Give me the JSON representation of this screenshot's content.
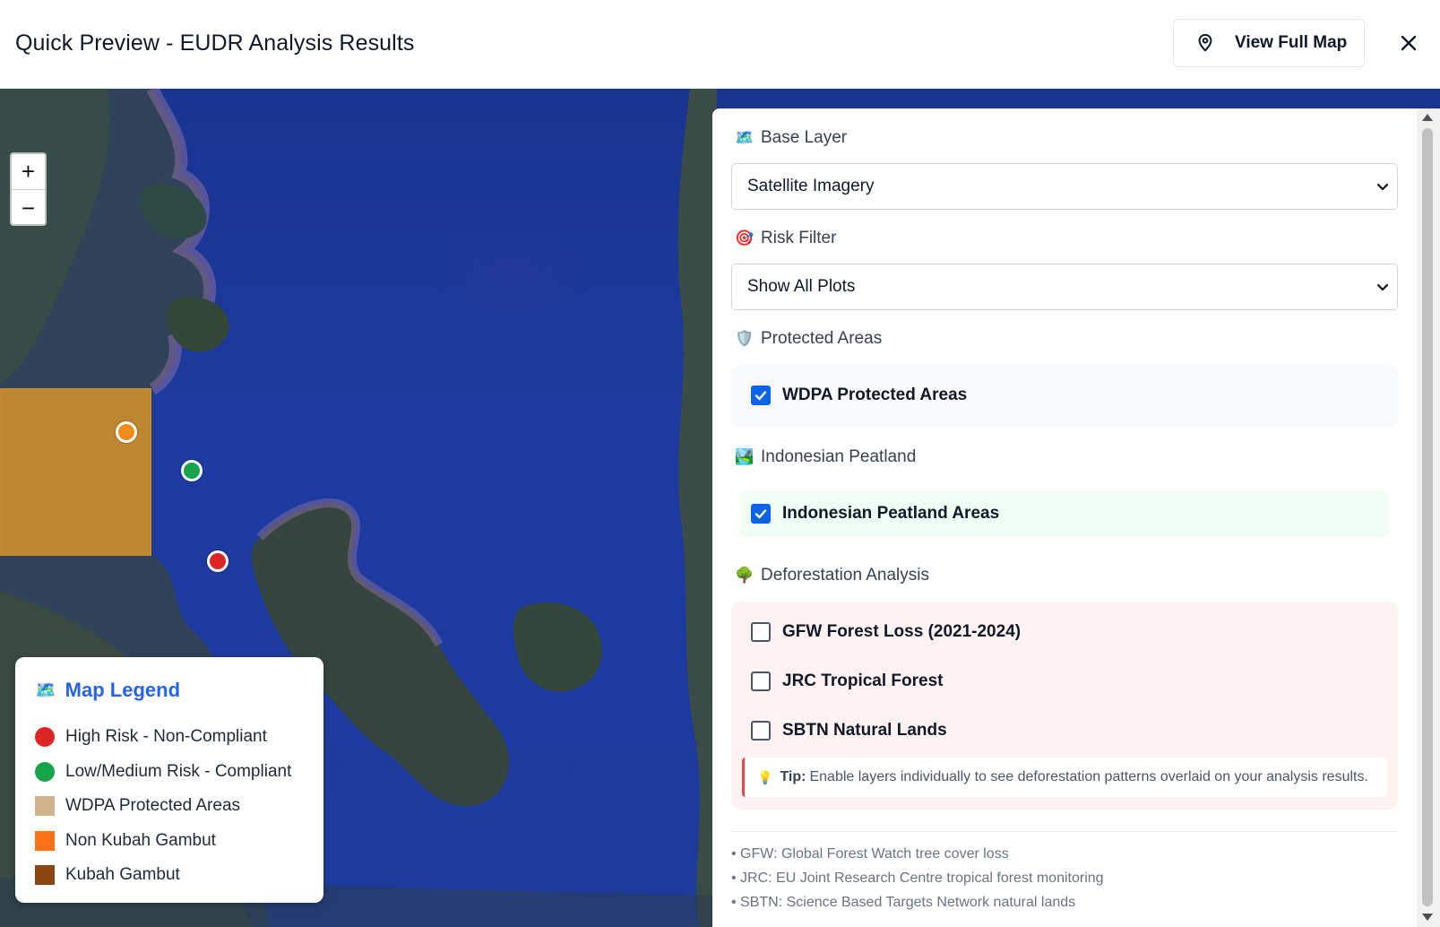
{
  "header": {
    "title": "Quick Preview - EUDR Analysis Results",
    "view_full_map": "View Full Map",
    "close_icon": "close-icon"
  },
  "map": {
    "zoom_in": "+",
    "zoom_out": "−",
    "markers": [
      {
        "risk": "non-kubah-gambut",
        "color": "#f28c1c"
      },
      {
        "risk": "low-medium",
        "color": "#16a34a"
      },
      {
        "risk": "high",
        "color": "#dc2626"
      }
    ]
  },
  "legend": {
    "title": "Map Legend",
    "items": [
      {
        "label": "High Risk - Non-Compliant",
        "color": "#dc2626",
        "shape": "circle"
      },
      {
        "label": "Low/Medium Risk - Compliant",
        "color": "#16a34a",
        "shape": "circle"
      },
      {
        "label": "WDPA Protected Areas",
        "color": "#d2b48c",
        "shape": "square"
      },
      {
        "label": "Non Kubah Gambut",
        "color": "#f97316",
        "shape": "square"
      },
      {
        "label": "Kubah Gambut",
        "color": "#8b4513",
        "shape": "square"
      }
    ]
  },
  "panel": {
    "base_layer": {
      "label": "Base Layer",
      "value": "Satellite Imagery"
    },
    "risk_filter": {
      "label": "Risk Filter",
      "value": "Show All Plots"
    },
    "protected_areas": {
      "label": "Protected Areas",
      "option": "WDPA Protected Areas",
      "checked": true
    },
    "peatland": {
      "label": "Indonesian Peatland",
      "option": "Indonesian Peatland Areas",
      "checked": true
    },
    "deforestation": {
      "label": "Deforestation Analysis",
      "options": [
        {
          "label": "GFW Forest Loss (2021-2024)",
          "checked": false
        },
        {
          "label": "JRC Tropical Forest",
          "checked": false
        },
        {
          "label": "SBTN Natural Lands",
          "checked": false
        }
      ],
      "tip_label": "Tip:",
      "tip_text": "Enable layers individually to see deforestation patterns overlaid on your analysis results."
    },
    "notes": [
      "• GFW: Global Forest Watch tree cover loss",
      "• JRC: EU Joint Research Centre tropical forest monitoring",
      "• SBTN: Science Based Targets Network natural lands"
    ]
  },
  "colors": {
    "accent": "#2563eb",
    "checkbox": "#0b63e5",
    "peatland_bg": "#f0fdf4",
    "deforestation_bg": "#fef2f2",
    "protected_bg": "#f9fafb"
  }
}
